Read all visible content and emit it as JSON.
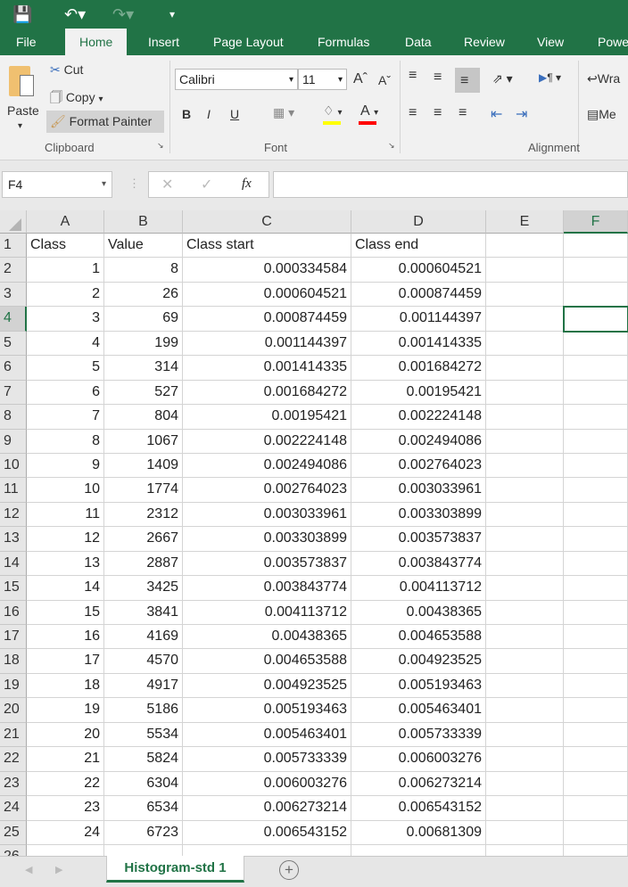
{
  "quick_access": {
    "save_icon": "save-icon",
    "undo_icon": "undo-icon",
    "redo_icon": "redo-icon",
    "customize_icon": "customize-qat-icon"
  },
  "tabs": [
    "File",
    "Home",
    "Insert",
    "Page Layout",
    "Formulas",
    "Data",
    "Review",
    "View",
    "Powe"
  ],
  "active_tab": "Home",
  "ribbon": {
    "clipboard": {
      "paste": "Paste",
      "cut": "Cut",
      "copy": "Copy",
      "format_painter": "Format Painter",
      "group": "Clipboard"
    },
    "font": {
      "name": "Calibri",
      "size": "11",
      "bold": "B",
      "italic": "I",
      "underline": "U",
      "group": "Font",
      "fill_color": "#ffff00",
      "font_color": "#ff0000"
    },
    "alignment": {
      "wrap": "Wra",
      "merge": "Me",
      "group": "Alignment"
    }
  },
  "formula_bar": {
    "name_box": "F4",
    "fx": "fx",
    "value": ""
  },
  "columns": [
    "A",
    "B",
    "C",
    "D",
    "E",
    "F"
  ],
  "selected_cell": "F4",
  "rows": [
    [
      "Class",
      "Value",
      "Class start",
      "Class end"
    ],
    [
      "1",
      "8",
      "0.000334584",
      "0.000604521"
    ],
    [
      "2",
      "26",
      "0.000604521",
      "0.000874459"
    ],
    [
      "3",
      "69",
      "0.000874459",
      "0.001144397"
    ],
    [
      "4",
      "199",
      "0.001144397",
      "0.001414335"
    ],
    [
      "5",
      "314",
      "0.001414335",
      "0.001684272"
    ],
    [
      "6",
      "527",
      "0.001684272",
      "0.00195421"
    ],
    [
      "7",
      "804",
      "0.00195421",
      "0.002224148"
    ],
    [
      "8",
      "1067",
      "0.002224148",
      "0.002494086"
    ],
    [
      "9",
      "1409",
      "0.002494086",
      "0.002764023"
    ],
    [
      "10",
      "1774",
      "0.002764023",
      "0.003033961"
    ],
    [
      "11",
      "2312",
      "0.003033961",
      "0.003303899"
    ],
    [
      "12",
      "2667",
      "0.003303899",
      "0.003573837"
    ],
    [
      "13",
      "2887",
      "0.003573837",
      "0.003843774"
    ],
    [
      "14",
      "3425",
      "0.003843774",
      "0.004113712"
    ],
    [
      "15",
      "3841",
      "0.004113712",
      "0.00438365"
    ],
    [
      "16",
      "4169",
      "0.00438365",
      "0.004653588"
    ],
    [
      "17",
      "4570",
      "0.004653588",
      "0.004923525"
    ],
    [
      "18",
      "4917",
      "0.004923525",
      "0.005193463"
    ],
    [
      "19",
      "5186",
      "0.005193463",
      "0.005463401"
    ],
    [
      "20",
      "5534",
      "0.005463401",
      "0.005733339"
    ],
    [
      "21",
      "5824",
      "0.005733339",
      "0.006003276"
    ],
    [
      "22",
      "6304",
      "0.006003276",
      "0.006273214"
    ],
    [
      "23",
      "6534",
      "0.006273214",
      "0.006543152"
    ],
    [
      "24",
      "6723",
      "0.006543152",
      "0.00681309"
    ]
  ],
  "sheet_tab": "Histogram-std 1",
  "accent": "#217346"
}
